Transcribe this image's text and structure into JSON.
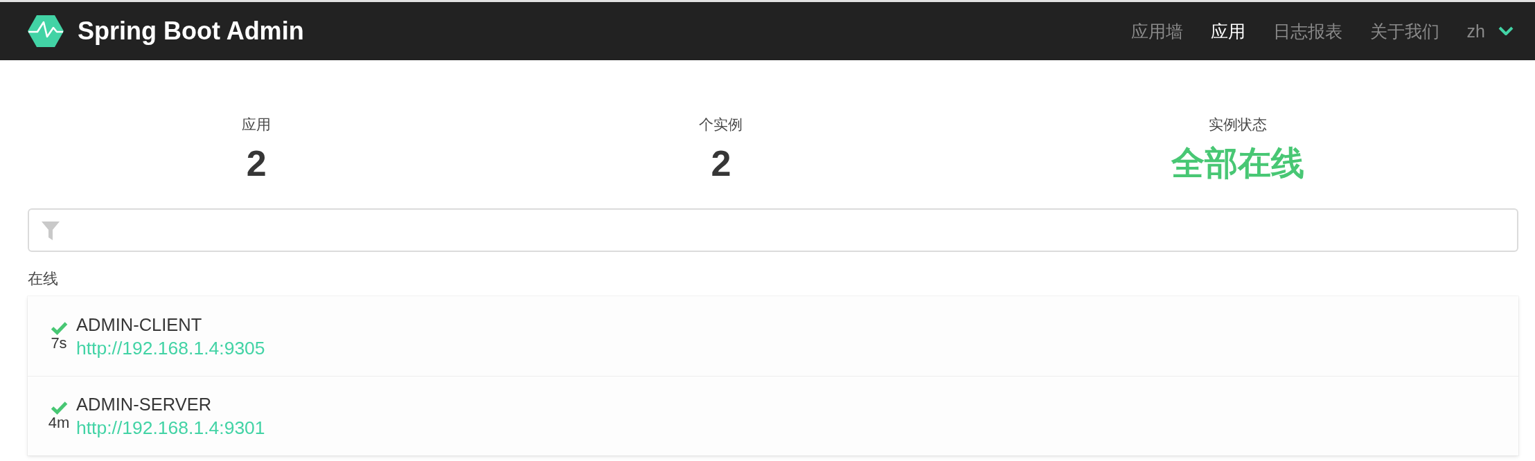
{
  "navbar": {
    "brand": "Spring Boot Admin",
    "items": [
      {
        "label": "应用墙",
        "selected": false
      },
      {
        "label": "应用",
        "selected": true
      },
      {
        "label": "日志报表",
        "selected": false
      },
      {
        "label": "关于我们",
        "selected": false
      }
    ],
    "language": {
      "label": "zh"
    }
  },
  "stats": [
    {
      "kind": "count",
      "label": "应用",
      "value": "2"
    },
    {
      "kind": "count",
      "label": "个实例",
      "value": "2"
    },
    {
      "kind": "status",
      "label": "实例状态",
      "value": "全部在线"
    }
  ],
  "groups": [
    {
      "label": "在线",
      "applications": [
        {
          "up": true,
          "uptime": "7s",
          "name": "ADMIN-CLIENT",
          "url": "http://192.168.1.4:9305"
        },
        {
          "up": true,
          "uptime": "4m",
          "name": "ADMIN-SERVER",
          "url": "http://192.168.1.4:9301"
        }
      ]
    }
  ]
}
